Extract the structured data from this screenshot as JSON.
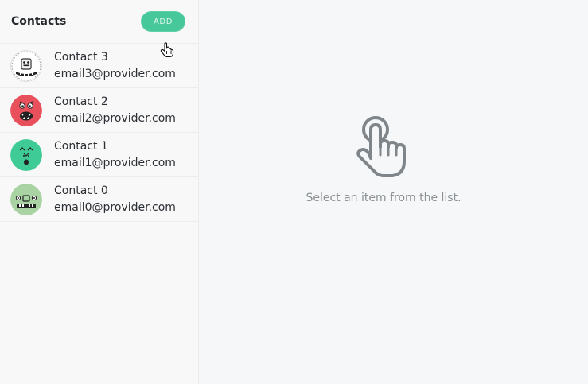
{
  "sidebar": {
    "title": "Contacts",
    "add_label": "ADD",
    "contacts": [
      {
        "name": "Contact 3",
        "email": "email3@provider.com",
        "avatar_color": "#ffffff"
      },
      {
        "name": "Contact 2",
        "email": "email2@provider.com",
        "avatar_color": "#e8505b"
      },
      {
        "name": "Contact 1",
        "email": "email1@provider.com",
        "avatar_color": "#3ecb96"
      },
      {
        "name": "Contact 0",
        "email": "email0@provider.com",
        "avatar_color": "#a9d3a2"
      }
    ]
  },
  "main": {
    "empty_message": "Select an item from the list.",
    "icon": "pointing-hand-icon"
  },
  "colors": {
    "accent": "#46c89a",
    "text": "#2b2f33",
    "muted": "#8a9094"
  }
}
